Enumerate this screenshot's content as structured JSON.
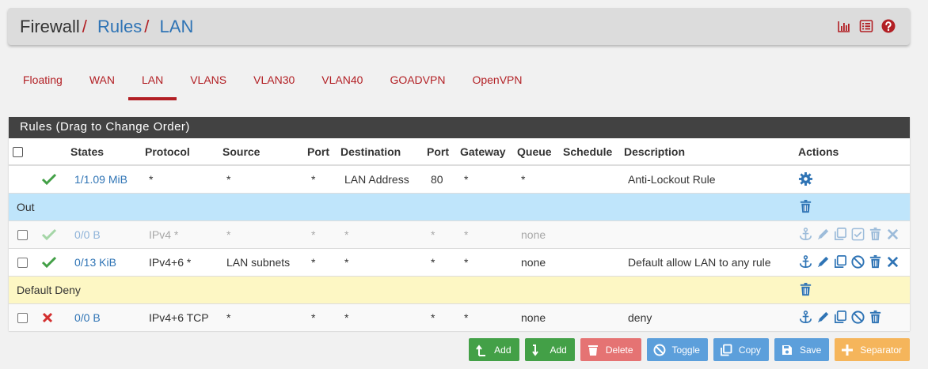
{
  "breadcrumb": {
    "root": "Firewall",
    "sep": "/",
    "section": "Rules",
    "page": "LAN"
  },
  "header_icons": [
    "chart-icon",
    "list-icon",
    "help-icon"
  ],
  "tabs": [
    {
      "label": "Floating",
      "active": false
    },
    {
      "label": "WAN",
      "active": false
    },
    {
      "label": "LAN",
      "active": true
    },
    {
      "label": "VLANS",
      "active": false
    },
    {
      "label": "VLAN30",
      "active": false
    },
    {
      "label": "VLAN40",
      "active": false
    },
    {
      "label": "GOADVPN",
      "active": false
    },
    {
      "label": "OpenVPN",
      "active": false
    }
  ],
  "panel": {
    "title": "Rules (Drag to Change Order)"
  },
  "columns": [
    "States",
    "Protocol",
    "Source",
    "Port",
    "Destination",
    "Port",
    "Gateway",
    "Queue",
    "Schedule",
    "Description",
    "Actions"
  ],
  "rows": [
    {
      "type": "rule",
      "checkbox": false,
      "status": "pass",
      "states": "1/1.09 MiB",
      "protocol": "*",
      "source": "*",
      "src_port": "*",
      "destination": "LAN Address",
      "dst_port": "80",
      "gateway": "*",
      "queue": "*",
      "schedule": "",
      "description": "Anti-Lockout Rule",
      "actions": [
        "gear-icon"
      ]
    },
    {
      "type": "separator",
      "color": "blue",
      "label": "Out"
    },
    {
      "type": "rule",
      "checkbox": true,
      "disabled": true,
      "status": "pass",
      "states": "0/0 B",
      "protocol": "IPv4 *",
      "source": "*",
      "src_port": "*",
      "destination": "*",
      "dst_port": "*",
      "gateway": "*",
      "queue": "none",
      "schedule": "",
      "description": "",
      "actions": [
        "anchor-icon",
        "pencil-icon",
        "copy-icon",
        "enable-check-icon",
        "trash-icon",
        "close-icon"
      ]
    },
    {
      "type": "rule",
      "checkbox": true,
      "status": "pass",
      "states": "0/13 KiB",
      "protocol": "IPv4+6 *",
      "source": "LAN subnets",
      "src_port": "*",
      "destination": "*",
      "dst_port": "*",
      "gateway": "*",
      "queue": "none",
      "schedule": "",
      "description": "Default allow LAN to any rule",
      "actions": [
        "anchor-icon",
        "pencil-icon",
        "copy-icon",
        "ban-icon",
        "trash-icon",
        "close-icon"
      ]
    },
    {
      "type": "separator",
      "color": "yellow",
      "label": "Default Deny"
    },
    {
      "type": "rule",
      "checkbox": true,
      "status": "block",
      "states": "0/0 B",
      "protocol": "IPv4+6 TCP",
      "source": "*",
      "src_port": "*",
      "destination": "*",
      "dst_port": "*",
      "gateway": "*",
      "queue": "none",
      "schedule": "",
      "description": "deny",
      "actions": [
        "anchor-icon",
        "pencil-icon",
        "copy-icon",
        "ban-icon",
        "trash-icon"
      ]
    }
  ],
  "buttons": [
    {
      "label": "Add",
      "icon": "arrow-up-icon",
      "color": "#43a047"
    },
    {
      "label": "Add",
      "icon": "arrow-down-icon",
      "color": "#43a047"
    },
    {
      "label": "Delete",
      "icon": "trash-icon",
      "color": "#e57373"
    },
    {
      "label": "Toggle",
      "icon": "ban-icon",
      "color": "#5c9fdb"
    },
    {
      "label": "Copy",
      "icon": "copy-icon",
      "color": "#5c9fdb"
    },
    {
      "label": "Save",
      "icon": "save-icon",
      "color": "#5c9fdb"
    },
    {
      "label": "Separator",
      "icon": "plus-icon",
      "color": "#f5b55b"
    }
  ],
  "colors": {
    "accent_red": "#b21f24",
    "link_blue": "#2f74b5",
    "pass_green": "#43a047",
    "block_red": "#d32f2f"
  }
}
